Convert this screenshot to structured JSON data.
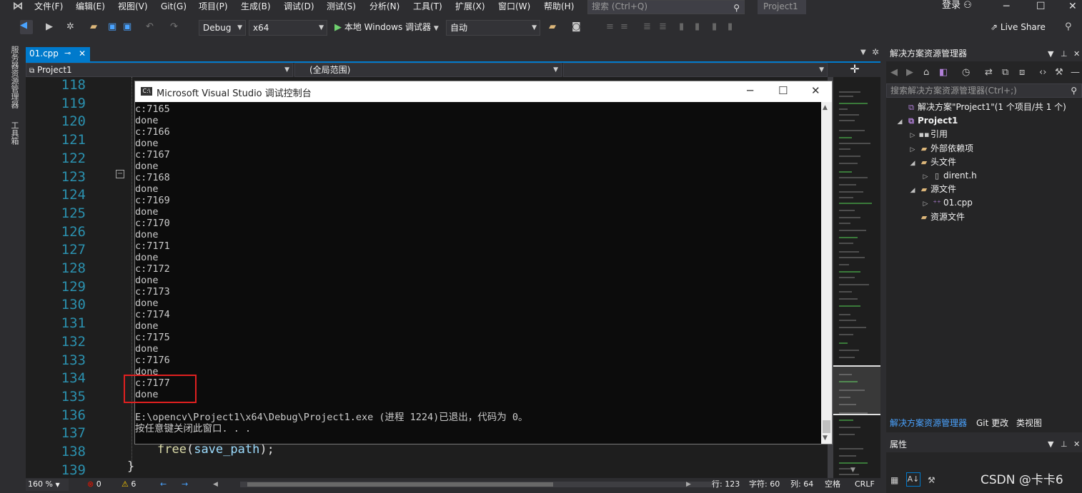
{
  "menu": {
    "items": [
      "文件(F)",
      "编辑(E)",
      "视图(V)",
      "Git(G)",
      "项目(P)",
      "生成(B)",
      "调试(D)",
      "测试(S)",
      "分析(N)",
      "工具(T)",
      "扩展(X)",
      "窗口(W)",
      "帮助(H)"
    ],
    "search_placeholder": "搜索 (Ctrl+Q)",
    "project_title": "Project1",
    "login": "登录"
  },
  "toolbar": {
    "config": "Debug",
    "platform": "x64",
    "run_label": "本地 Windows 调试器",
    "run_mode": "自动",
    "live_share": "Live Share"
  },
  "side_tabs": [
    "服务器资源管理器",
    "工具箱"
  ],
  "editor": {
    "tab_label": "01.cpp",
    "nav_project": "Project1",
    "nav_scope": "(全局范围)",
    "line_numbers": [
      "118",
      "119",
      "120",
      "121",
      "122",
      "123",
      "124",
      "125",
      "126",
      "127",
      "128",
      "129",
      "130",
      "131",
      "132",
      "133",
      "134",
      "135",
      "136",
      "137",
      "138",
      "139"
    ],
    "code_fn": "free",
    "code_paren_open": "(",
    "code_var": "save_path",
    "code_tail": ");",
    "code_brace": "}"
  },
  "console": {
    "title": "Microsoft Visual Studio 调试控制台",
    "icon_text": "C:\\",
    "lines": [
      "c:7165",
      "done",
      "c:7166",
      "done",
      "c:7167",
      "done",
      "c:7168",
      "done",
      "c:7169",
      "done",
      "c:7170",
      "done",
      "c:7171",
      "done",
      "c:7172",
      "done",
      "c:7173",
      "done",
      "c:7174",
      "done",
      "c:7175",
      "done",
      "c:7176",
      "done",
      "c:7177",
      "done",
      "",
      "E:\\opencv\\Project1\\x64\\Debug\\Project1.exe (进程 1224)已退出，代码为 0。",
      "按任意键关闭此窗口. . ."
    ]
  },
  "status": {
    "zoom": "160 %",
    "errors": "0",
    "warnings": "6",
    "line": "行: 123",
    "char": "字符: 60",
    "col": "列: 64",
    "whitespace": "空格",
    "eol": "CRLF"
  },
  "solution_explorer": {
    "title": "解决方案资源管理器",
    "search_placeholder": "搜索解决方案资源管理器(Ctrl+;)",
    "tree": [
      {
        "label": "解决方案\"Project1\"(1 个项目/共 1 个)",
        "twisty": "",
        "icon": "solution-icon"
      },
      {
        "label": "Project1",
        "twisty": "◢",
        "icon": "project-icon"
      },
      {
        "label": "引用",
        "twisty": "▷",
        "icon": "references-icon"
      },
      {
        "label": "外部依赖项",
        "twisty": "▷",
        "icon": "folder-icon"
      },
      {
        "label": "头文件",
        "twisty": "◢",
        "icon": "folder-icon"
      },
      {
        "label": "dirent.h",
        "twisty": "▷",
        "icon": "header-file-icon"
      },
      {
        "label": "源文件",
        "twisty": "◢",
        "icon": "folder-icon"
      },
      {
        "label": "01.cpp",
        "twisty": "▷",
        "icon": "cpp-file-icon"
      },
      {
        "label": "资源文件",
        "twisty": "",
        "icon": "folder-icon"
      }
    ],
    "tabs": [
      "解决方案资源管理器",
      "Git 更改",
      "类视图"
    ]
  },
  "properties": {
    "title": "属性"
  },
  "watermark": "CSDN @卡卡6",
  "colors": {
    "accent": "#007acc",
    "background": "#2d2d30",
    "editor_bg": "#1e1e1e",
    "highlight": "#e02020",
    "line_number": "#2b91af"
  }
}
